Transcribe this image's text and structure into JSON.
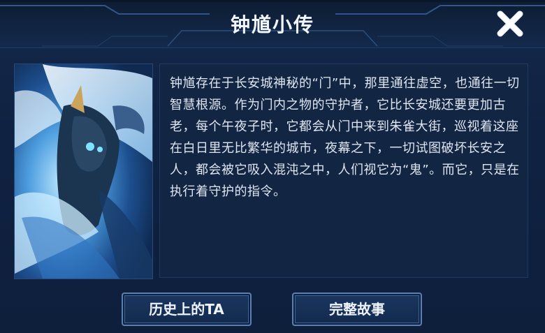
{
  "header": {
    "title": "钟馗小传"
  },
  "close_button": {
    "icon": "close-icon"
  },
  "portrait": {
    "icon": "hero-portrait"
  },
  "story": {
    "text": "钟馗存在于长安城神秘的“门”中，那里通往虚空，也通往一切智慧根源。作为门内之物的守护者，它比长安城还要更加古老，每个午夜子时，它都会从门中来到朱雀大街，巡视着这座在白日里无比繁华的城市，夜幕之下，一切试图破坏长安之人，都会被它吸入混沌之中，人们视它为“鬼”。而它，只是在执行着守护的指令。"
  },
  "buttons": {
    "history_label": "历史上的TA",
    "story_label": "完整故事"
  },
  "colors": {
    "background": "#102242",
    "frame_accent": "#3d6496",
    "text": "#dfe6f2"
  }
}
